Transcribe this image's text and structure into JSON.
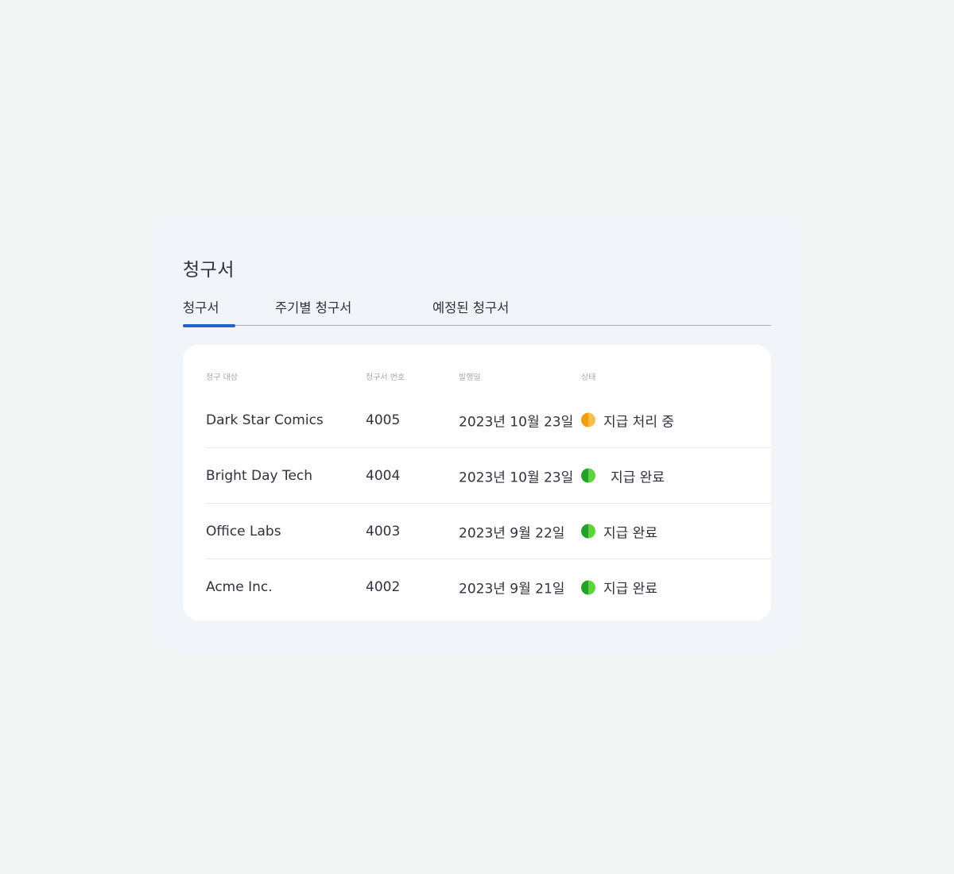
{
  "page": {
    "title": "청구서"
  },
  "tabs": [
    {
      "label": "청구서",
      "active": true
    },
    {
      "label": "주기별 청구서",
      "active": false
    },
    {
      "label": "예정된 청구서",
      "active": false
    }
  ],
  "table": {
    "columns": [
      "청구 대상",
      "청구서 번호",
      "발행일",
      "상태"
    ],
    "rows": [
      {
        "customer": "Dark Star Comics",
        "number": "4005",
        "date": "2023년 10월 23일",
        "status": "지급 처리 중",
        "status_color": "#f29c0f"
      },
      {
        "customer": "Bright Day Tech",
        "number": "4004",
        "date": "2023년 10월 23일",
        "status": "지급 완료",
        "status_color": "#23a12a"
      },
      {
        "customer": "Office Labs",
        "number": "4003",
        "date": "2023년 9월 22일",
        "status": "지급 완료",
        "status_color": "#23a12a"
      },
      {
        "customer": "Acme Inc.",
        "number": "4002",
        "date": "2023년 9월 21일",
        "status": "지급 완료",
        "status_color": "#23a12a"
      }
    ]
  },
  "colors": {
    "accent": "#1f66d1",
    "background": "#f2f6f5",
    "panel": "#f1f4f8",
    "card": "#ffffff",
    "text": "#30313d",
    "muted": "#a3a8b1"
  },
  "icons": {
    "status_pending": "status-dot-orange-icon",
    "status_paid": "status-dot-green-icon"
  }
}
